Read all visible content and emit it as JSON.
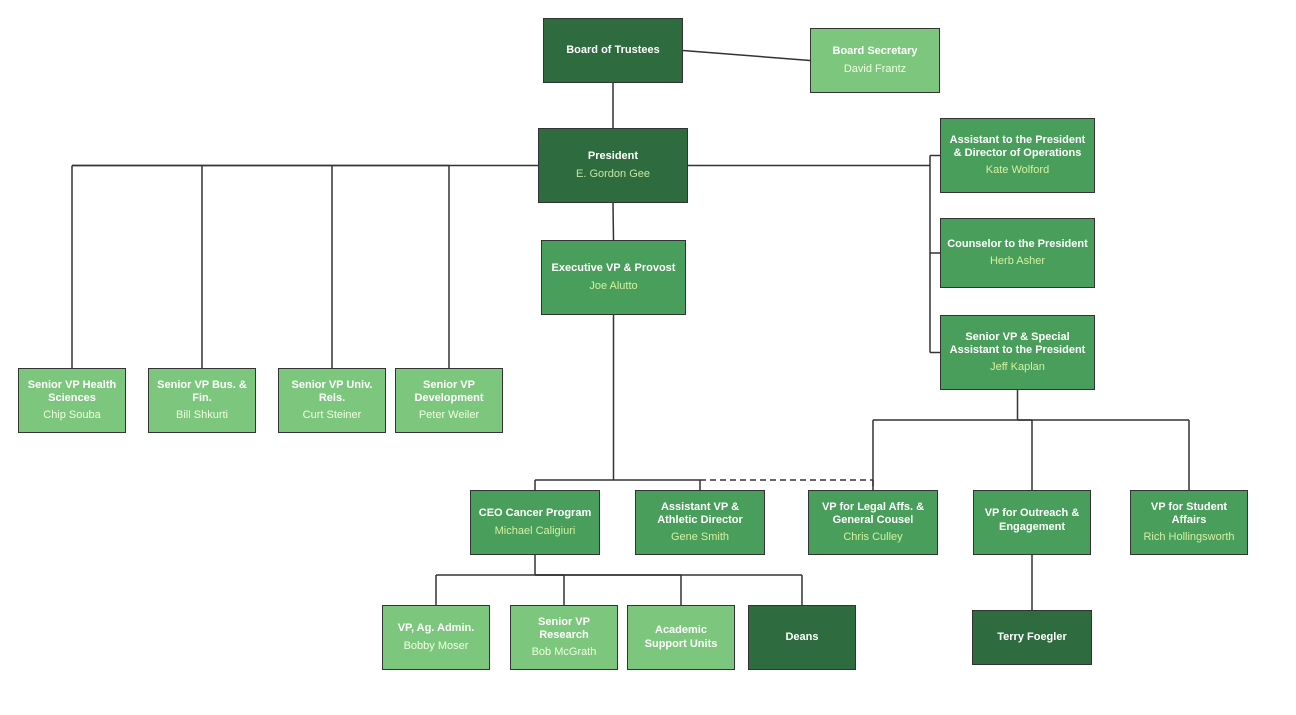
{
  "nodes": {
    "board": {
      "title": "Board of Trustees",
      "name": ""
    },
    "board_secretary": {
      "title": "Board Secretary",
      "name": "David Frantz"
    },
    "president": {
      "title": "President",
      "name": "E. Gordon Gee"
    },
    "asst_president": {
      "title": "Assistant to the President & Director of Operations",
      "name": "Kate Wolford"
    },
    "counselor": {
      "title": "Counselor to the President",
      "name": "Herb Asher"
    },
    "senior_vp_special": {
      "title": "Senior VP & Special Assistant to the President",
      "name": "Jeff Kaplan"
    },
    "evp_provost": {
      "title": "Executive VP & Provost",
      "name": "Joe Alutto"
    },
    "svp_health": {
      "title": "Senior VP Health Sciences",
      "name": "Chip Souba"
    },
    "svp_bus": {
      "title": "Senior VP Bus. & Fin.",
      "name": "Bill Shkurti"
    },
    "svp_univ": {
      "title": "Senior VP Univ. Rels.",
      "name": "Curt Steiner"
    },
    "svp_dev": {
      "title": "Senior VP Development",
      "name": "Peter Weiler"
    },
    "ceo_cancer": {
      "title": "CEO Cancer Program",
      "name": "Michael Caligiuri"
    },
    "asst_vp_athletic": {
      "title": "Assistant VP & Athletic Director",
      "name": "Gene Smith"
    },
    "vp_legal": {
      "title": "VP for Legal Affs. & General Cousel",
      "name": "Chris Culley"
    },
    "vp_outreach": {
      "title": "VP for Outreach & Engagement",
      "name": ""
    },
    "vp_student": {
      "title": "VP for Student Affairs",
      "name": "Rich Hollingsworth"
    },
    "vp_ag": {
      "title": "VP, Ag. Admin.",
      "name": "Bobby Moser"
    },
    "svp_research": {
      "title": "Senior VP Research",
      "name": "Bob McGrath"
    },
    "academic_support": {
      "title": "Academic Support Units",
      "name": ""
    },
    "deans": {
      "title": "Deans",
      "name": ""
    },
    "terry": {
      "title": "Terry Foegler",
      "name": ""
    }
  }
}
